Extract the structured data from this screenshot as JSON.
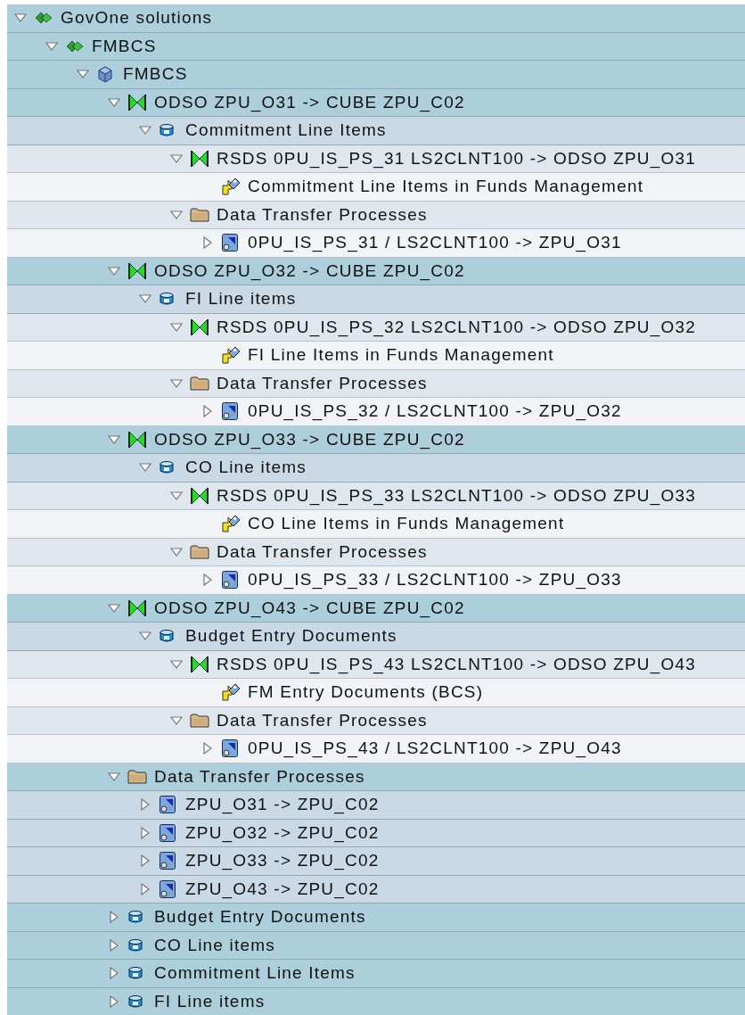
{
  "tree": [
    {
      "label": "GovOne solutions",
      "kind": "solution",
      "expanded": true,
      "children": [
        {
          "label": "FMBCS",
          "kind": "solution",
          "expanded": true,
          "children": [
            {
              "label": "FMBCS",
              "kind": "infoarea",
              "expanded": true,
              "children": [
                {
                  "label": "ODSO ZPU_O31 -> CUBE ZPU_C02",
                  "kind": "transformation",
                  "expanded": true,
                  "children": [
                    {
                      "label": "Commitment Line Items",
                      "kind": "cylinder",
                      "expanded": true,
                      "children": [
                        {
                          "label": "RSDS 0PU_IS_PS_31 LS2CLNT100 -> ODSO ZPU_O31",
                          "kind": "transformation",
                          "expanded": true,
                          "children": [
                            {
                              "label": "Commitment Line Items in Funds Management",
                              "kind": "datasource"
                            }
                          ]
                        },
                        {
                          "label": "Data Transfer Processes",
                          "kind": "folder",
                          "expanded": true,
                          "children": [
                            {
                              "label": "0PU_IS_PS_31 / LS2CLNT100 -> ZPU_O31",
                              "kind": "dtp",
                              "expanded": false
                            }
                          ]
                        }
                      ]
                    }
                  ]
                },
                {
                  "label": "ODSO ZPU_O32 -> CUBE ZPU_C02",
                  "kind": "transformation",
                  "expanded": true,
                  "children": [
                    {
                      "label": "FI Line items",
                      "kind": "cylinder",
                      "expanded": true,
                      "children": [
                        {
                          "label": "RSDS 0PU_IS_PS_32 LS2CLNT100 -> ODSO ZPU_O32",
                          "kind": "transformation",
                          "expanded": true,
                          "children": [
                            {
                              "label": "FI Line Items in Funds Management",
                              "kind": "datasource"
                            }
                          ]
                        },
                        {
                          "label": "Data Transfer Processes",
                          "kind": "folder",
                          "expanded": true,
                          "children": [
                            {
                              "label": "0PU_IS_PS_32 / LS2CLNT100 -> ZPU_O32",
                              "kind": "dtp",
                              "expanded": false
                            }
                          ]
                        }
                      ]
                    }
                  ]
                },
                {
                  "label": "ODSO ZPU_O33 -> CUBE ZPU_C02",
                  "kind": "transformation",
                  "expanded": true,
                  "children": [
                    {
                      "label": "CO Line items",
                      "kind": "cylinder",
                      "expanded": true,
                      "children": [
                        {
                          "label": "RSDS 0PU_IS_PS_33 LS2CLNT100 -> ODSO ZPU_O33",
                          "kind": "transformation",
                          "expanded": true,
                          "children": [
                            {
                              "label": "CO Line Items in Funds Management",
                              "kind": "datasource"
                            }
                          ]
                        },
                        {
                          "label": "Data Transfer Processes",
                          "kind": "folder",
                          "expanded": true,
                          "children": [
                            {
                              "label": "0PU_IS_PS_33 / LS2CLNT100 -> ZPU_O33",
                              "kind": "dtp",
                              "expanded": false
                            }
                          ]
                        }
                      ]
                    }
                  ]
                },
                {
                  "label": "ODSO ZPU_O43 -> CUBE ZPU_C02",
                  "kind": "transformation",
                  "expanded": true,
                  "children": [
                    {
                      "label": "Budget Entry Documents",
                      "kind": "cylinder",
                      "expanded": true,
                      "children": [
                        {
                          "label": "RSDS 0PU_IS_PS_43 LS2CLNT100 -> ODSO ZPU_O43",
                          "kind": "transformation",
                          "expanded": true,
                          "children": [
                            {
                              "label": "FM Entry Documents (BCS)",
                              "kind": "datasource"
                            }
                          ]
                        },
                        {
                          "label": "Data Transfer Processes",
                          "kind": "folder",
                          "expanded": true,
                          "children": [
                            {
                              "label": "0PU_IS_PS_43 / LS2CLNT100 -> ZPU_O43",
                              "kind": "dtp",
                              "expanded": false
                            }
                          ]
                        }
                      ]
                    }
                  ]
                },
                {
                  "label": "Data Transfer Processes",
                  "kind": "folder",
                  "expanded": true,
                  "children": [
                    {
                      "label": "ZPU_O31 -> ZPU_C02",
                      "kind": "dtp",
                      "expanded": false
                    },
                    {
                      "label": "ZPU_O32 -> ZPU_C02",
                      "kind": "dtp",
                      "expanded": false
                    },
                    {
                      "label": "ZPU_O33 -> ZPU_C02",
                      "kind": "dtp",
                      "expanded": false
                    },
                    {
                      "label": "ZPU_O43 -> ZPU_C02",
                      "kind": "dtp",
                      "expanded": false
                    }
                  ]
                },
                {
                  "label": "Budget Entry Documents",
                  "kind": "cylinder",
                  "expanded": false
                },
                {
                  "label": "CO Line items",
                  "kind": "cylinder",
                  "expanded": false
                },
                {
                  "label": "Commitment Line Items",
                  "kind": "cylinder",
                  "expanded": false
                },
                {
                  "label": "FI Line items",
                  "kind": "cylinder",
                  "expanded": false
                }
              ]
            }
          ]
        }
      ]
    }
  ]
}
